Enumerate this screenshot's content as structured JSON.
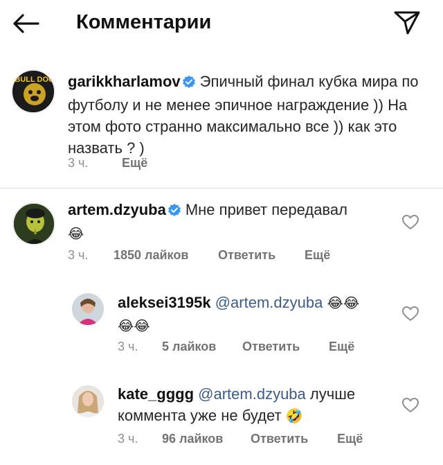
{
  "header": {
    "title": "Комментарии"
  },
  "caption": {
    "username": "garikkharlamov",
    "text": "Эпичный финал кубка мира по футболу и не менее эпичное награждение )) На этом фото странно максимально все )) как это назвать ? )",
    "time": "3 ч.",
    "more": "Ещё",
    "avatar_text": "BULL DOG"
  },
  "comments": [
    {
      "username": "artem.dzyuba",
      "text": "Мне привет передавал",
      "emoji": "😂",
      "time": "3 ч.",
      "likes": "1850 лайков",
      "reply": "Ответить",
      "more": "Ещё"
    },
    {
      "username": "aleksei3195k",
      "mention": "@artem.dzyuba",
      "emoji": "😂😂",
      "emoji2": "😂😂",
      "time": "3 ч.",
      "likes": "5 лайков",
      "reply": "Ответить",
      "more": "Ещё"
    },
    {
      "username": "kate_gggg",
      "mention": "@artem.dzyuba",
      "text": "лучше",
      "text2": "коммента уже не будет",
      "emoji": "🤣",
      "time": "3 ч.",
      "likes": "96 лайков",
      "reply": "Ответить",
      "more": "Ещё"
    }
  ],
  "colors": {
    "verified": "#3897f0",
    "mention": "#3b5c8a",
    "meta": "#8e8e8e"
  }
}
